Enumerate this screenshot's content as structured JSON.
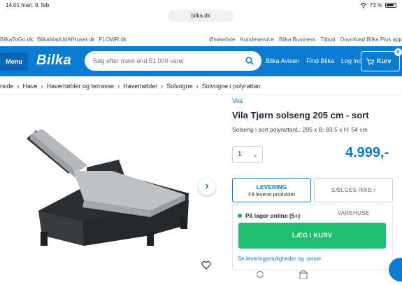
{
  "status_bar": {
    "time": "14.01",
    "date": "man. 9. feb.",
    "battery": "73 %"
  },
  "browser": {
    "url": "bilka.dk"
  },
  "top_links": {
    "left": [
      "BilkaToGo.dk",
      "BilkaMadUdAfHuset.dk",
      "FLOWR.dk"
    ],
    "right": [
      "Ønskeliste",
      "Kundeservice",
      "Bilka Business",
      "Tilbud",
      "Download Bilka Plus app"
    ]
  },
  "header": {
    "menu_label": "Menu",
    "logo": "Bilka",
    "search_placeholder": "Søg efter mere end 51.000 varer",
    "nav": [
      "Bilka Avisen",
      "Find Bilka",
      "Log ind"
    ],
    "cart_label": "Kurv",
    "cart_count": "0"
  },
  "breadcrumb": [
    "rside",
    "Have",
    "Havemøbler og terrasse",
    "Havemøbler",
    "Solvogne",
    "Solvogne i polyrattan"
  ],
  "product": {
    "brand": "Vila",
    "title": "Vila Tjørn solseng 205 cm - sort",
    "description": "Solseng i sort polyrattanL: 205 x B: 83,5 x H: 54 cm",
    "quantity": "1",
    "price": "4.999,-"
  },
  "delivery": {
    "tab_delivery_title": "LEVERING",
    "tab_delivery_sub": "Få leveret produktet",
    "tab_store": "SÆLGES IKKE I VAREHUSE",
    "stock": "På lager online (5+)",
    "add_to_cart": "LÆG I KURV",
    "options_link": "Se leveringsmuligheder og -priser"
  },
  "colors": {
    "brand_blue": "#0a7bd3",
    "cta_green": "#1fbf6f"
  }
}
